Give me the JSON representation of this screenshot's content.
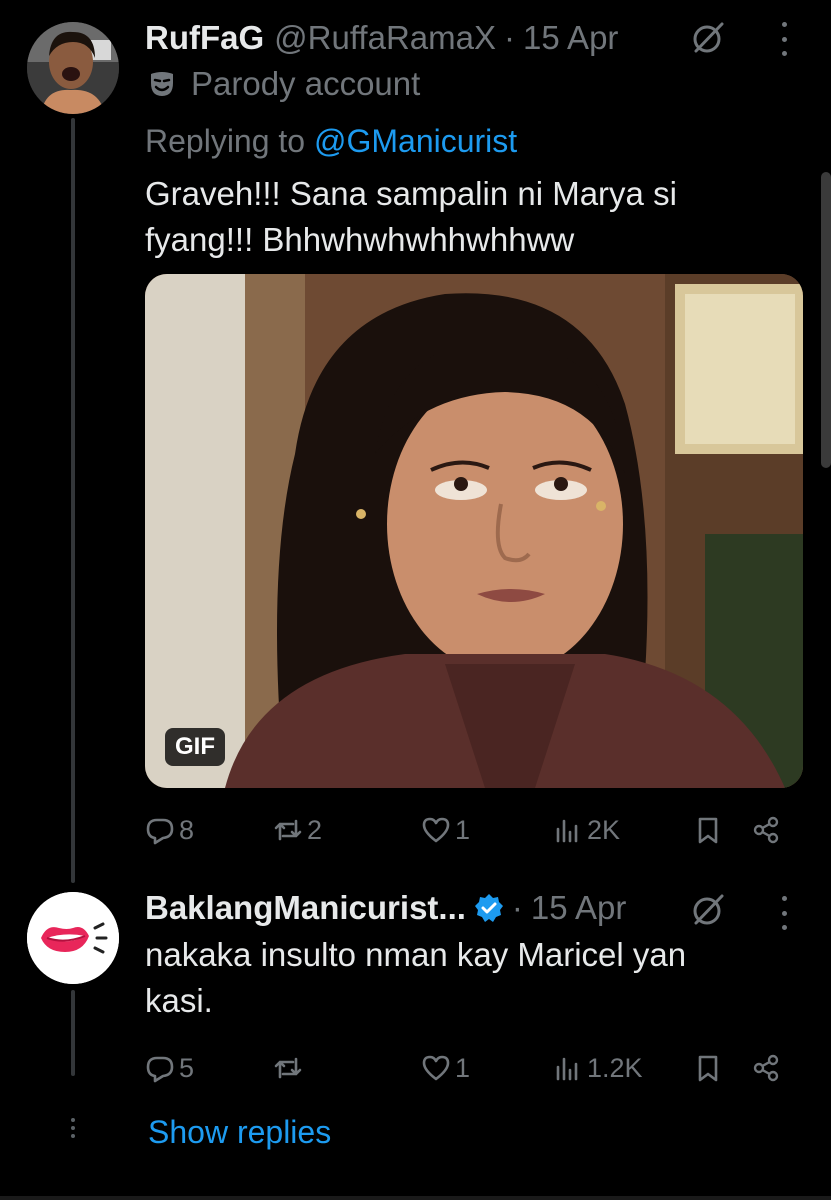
{
  "tweets": [
    {
      "display_name": "RufFaG",
      "handle": "@RuffaRamaX",
      "separator": "·",
      "time": "15 Apr",
      "parody_label": "Parody account",
      "replying_prefix": "Replying to ",
      "replying_mention": "@GManicurist",
      "text": "Graveh!!! Sana sampalin ni Marya si fyang!!! Bhhwhwhwhhwhhww",
      "media_badge": "GIF",
      "stats": {
        "replies": "8",
        "reposts": "2",
        "likes": "1",
        "views": "2K"
      }
    },
    {
      "display_name": "BaklangManicurist...",
      "separator": "·",
      "time": "15 Apr",
      "verified": true,
      "text": "nakaka insulto nman kay Maricel yan kasi.",
      "stats": {
        "replies": "5",
        "reposts": "",
        "likes": "1",
        "views": "1.2K"
      }
    }
  ],
  "show_replies": "Show replies",
  "colors": {
    "background": "#000000",
    "primary_text": "#e7e9ea",
    "secondary_text": "#71767b",
    "link": "#1d9bf0",
    "thread_line": "#333639"
  },
  "icons": [
    "mask-icon",
    "grok-icon",
    "more-icon",
    "verified-badge-icon",
    "reply-icon",
    "repost-icon",
    "like-icon",
    "views-icon",
    "bookmark-icon",
    "share-icon"
  ]
}
